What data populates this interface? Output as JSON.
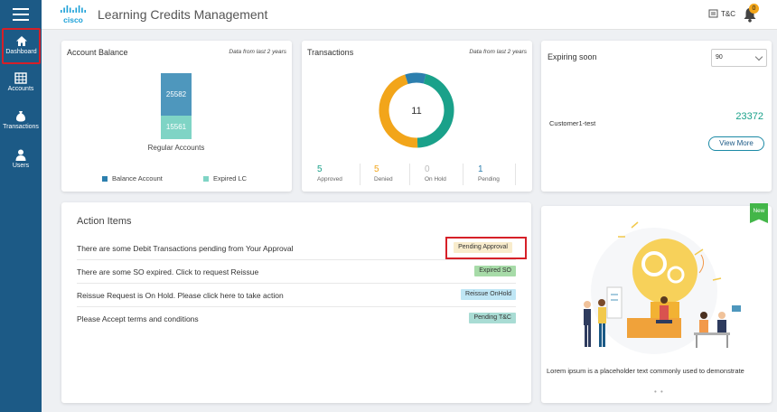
{
  "app": {
    "title": "Learning Credits Management",
    "logo_text": "cisco"
  },
  "header": {
    "tc_label": "T&C",
    "notification_count": "0"
  },
  "sidebar": {
    "items": [
      {
        "label": "Dashboard",
        "icon": "home-icon",
        "active": true
      },
      {
        "label": "Accounts",
        "icon": "grid-icon"
      },
      {
        "label": "Transactions",
        "icon": "money-bag-icon"
      },
      {
        "label": "Users",
        "icon": "user-icon"
      }
    ]
  },
  "account_balance": {
    "title": "Account Balance",
    "note": "Data from last 2 years",
    "bar_label": "Regular Accounts",
    "legend": [
      {
        "label": "Balance Account",
        "color": "#2c7fae"
      },
      {
        "label": "Expired LC",
        "color": "#7fd4c5"
      }
    ]
  },
  "transactions": {
    "title": "Transactions",
    "note": "Data from last 2 years",
    "total": "11",
    "stats": [
      {
        "value": "5",
        "label": "Approved",
        "color": "#1aa18a"
      },
      {
        "value": "5",
        "label": "Denied",
        "color": "#f2a51a"
      },
      {
        "value": "0",
        "label": "On Hold",
        "color": "#bbbbbb"
      },
      {
        "value": "1",
        "label": "Pending",
        "color": "#2c7fae"
      }
    ]
  },
  "expiring": {
    "title": "Expiring soon",
    "select_value": "90",
    "customer": "Customer1-test",
    "amount": "23372",
    "view_more": "View More"
  },
  "action_items": {
    "title": "Action Items",
    "rows": [
      {
        "text": "There are some Debit Transactions pending from Your Approval",
        "badge": "Pending Approval",
        "badge_bg": "#f8eccc"
      },
      {
        "text": "There are some SO expired. Click to request Reissue",
        "badge": "Expired SO",
        "badge_bg": "#a7dba8"
      },
      {
        "text": "Reissue Request is On Hold. Please click here to take action",
        "badge": "Reissue OnHold",
        "badge_bg": "#bfe6f5"
      },
      {
        "text": "Please Accept terms and conditions",
        "badge": "Pending T&C",
        "badge_bg": "#a9dcd4"
      }
    ]
  },
  "promo": {
    "badge": "New",
    "caption": "Lorem ipsum is a placeholder text commonly used to demonstrate",
    "dots": "• •"
  },
  "chart_data": [
    {
      "type": "bar",
      "categories": [
        "Regular Accounts"
      ],
      "series": [
        {
          "name": "Balance Account",
          "values": [
            25582
          ]
        },
        {
          "name": "Expired LC",
          "values": [
            15561
          ]
        }
      ],
      "stacked": true,
      "legend": "bottom"
    },
    {
      "type": "pie",
      "donut": true,
      "center_label": "11",
      "categories": [
        "Approved",
        "Denied",
        "On Hold",
        "Pending"
      ],
      "values": [
        5,
        5,
        0,
        1
      ],
      "colors": [
        "#1aa18a",
        "#f2a51a",
        "#bbbbbb",
        "#2c7fae"
      ]
    }
  ]
}
